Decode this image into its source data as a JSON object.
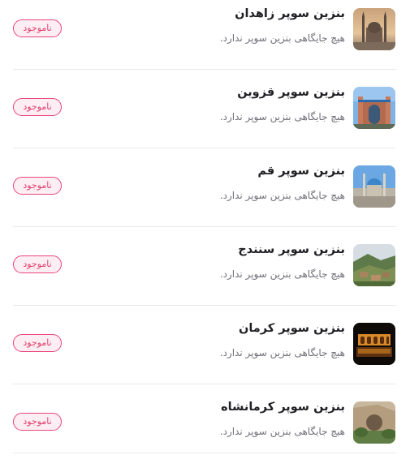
{
  "colors": {
    "badge_border": "#e8457a",
    "badge_bg": "#fdeef3",
    "badge_text": "#e0426f",
    "title_text": "#1f1f24",
    "subtitle_text": "#6f6f78",
    "divider": "#e9e9ee"
  },
  "items": [
    {
      "title": "بنزین سوپر زاهدان",
      "subtitle": "هیچ جایگاهی بنزین سوپر ندارد.",
      "status": "ناموجود",
      "image": "zahedan-mosque-photo"
    },
    {
      "title": "بنزین سوپر قزوین",
      "subtitle": "هیچ جایگاهی بنزین سوپر ندارد.",
      "status": "ناموجود",
      "image": "qazvin-gate-photo"
    },
    {
      "title": "بنزین سوپر قم",
      "subtitle": "هیچ جایگاهی بنزین سوپر ندارد.",
      "status": "ناموجود",
      "image": "qom-shrine-photo"
    },
    {
      "title": "بنزین سوپر سنندج",
      "subtitle": "هیچ جایگاهی بنزین سوپر ندارد.",
      "status": "ناموجود",
      "image": "sanandaj-village-photo"
    },
    {
      "title": "بنزین سوپر کرمان",
      "subtitle": "هیچ جایگاهی بنزین سوپر ندارد.",
      "status": "ناموجود",
      "image": "kerman-night-garden-photo"
    },
    {
      "title": "بنزین سوپر کرمانشاه",
      "subtitle": "هیچ جایگاهی بنزین سوپر ندارد.",
      "status": "ناموجود",
      "image": "kermanshah-taq-bostan-photo"
    }
  ]
}
